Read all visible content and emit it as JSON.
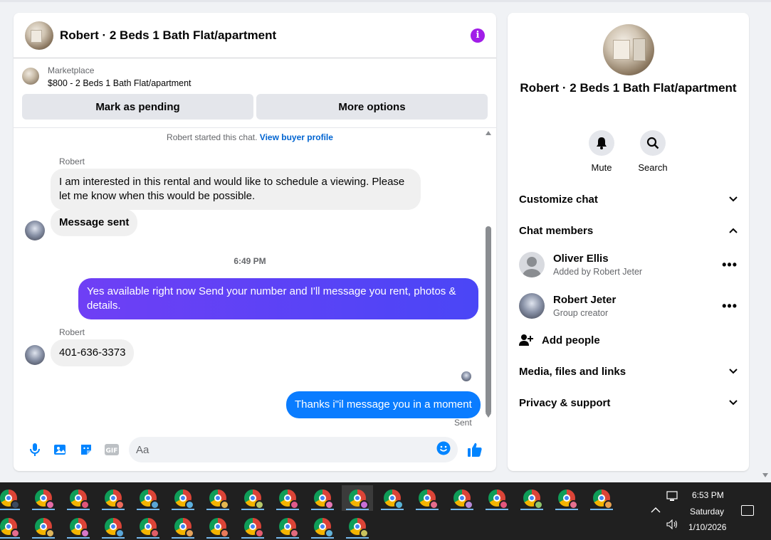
{
  "header": {
    "title": "Robert · 2 Beds 1 Bath Flat/apartment",
    "info_icon": "i"
  },
  "marketplace": {
    "label": "Marketplace",
    "listing": "$800 - 2 Beds 1 Bath Flat/apartment"
  },
  "buttons": {
    "mark_pending": "Mark as pending",
    "more_options": "More options"
  },
  "messages": {
    "started_text": "Robert started this chat. ",
    "started_link": "View buyer profile",
    "sender1": "Robert",
    "msg1": "I am interested in this rental and would like to schedule a viewing. Please let me know when this would be possible.",
    "msg2": "Message sent",
    "timestamp": "6:49 PM",
    "msg3": "Yes available right now Send your number and I'll message you rent, photos & details.",
    "sender2": "Robert",
    "msg4": "401-636-3373",
    "msg5": "Thanks i\"il message you in a moment",
    "sent_status": "Sent"
  },
  "composer": {
    "placeholder": "Aa"
  },
  "side": {
    "title": "Robert · 2 Beds 1 Bath Flat/apartment",
    "mute_label": "Mute",
    "search_label": "Search",
    "customize_chat": "Customize chat",
    "chat_members": "Chat members",
    "members": [
      {
        "name": "Oliver Ellis",
        "sub": "Added by Robert Jeter"
      },
      {
        "name": "Robert Jeter",
        "sub": "Group creator"
      }
    ],
    "add_people": "Add people",
    "media": "Media, files and links",
    "privacy": "Privacy & support"
  },
  "taskbar": {
    "time": "6:53 PM",
    "day": "Saturday",
    "date": "1/10/2026"
  },
  "colors": {
    "accent_purple": "#a11de8",
    "bubble_gradient_start": "#6f3ff5",
    "bubble_gradient_end": "#4a46f6",
    "bubble_blue": "#0a7cff",
    "messenger_blue": "#0084ff"
  }
}
